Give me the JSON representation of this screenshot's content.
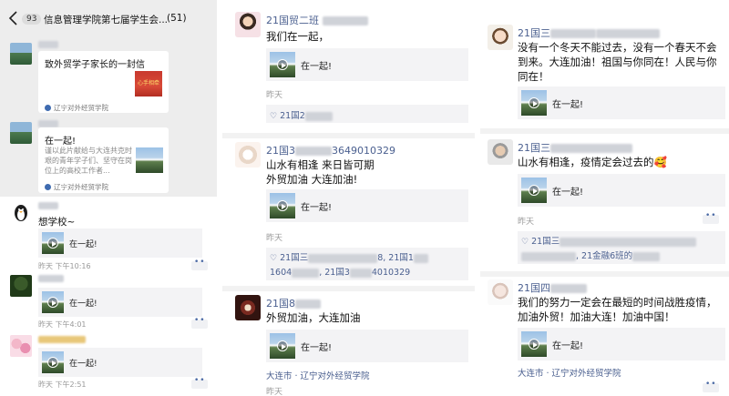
{
  "group_chat": {
    "header": {
      "badge": "93",
      "title": "信息管理学院第七届学生会...",
      "count": "(51)"
    },
    "card1": {
      "title": "致外贸学子家长的一封信",
      "source": "辽宁对外经贸学院"
    },
    "card2": {
      "title": "在一起!",
      "desc": "谨以此片献给与大连共克时艰的青年学子们、坚守在岗位上的高校工作者...",
      "source": "辽宁对外经贸学院"
    },
    "moments": [
      {
        "text": "想学校~",
        "share": "在一起!",
        "time": "昨天 下午10:16"
      },
      {
        "text": "",
        "share": "在一起!",
        "time": "昨天 下午4:01"
      },
      {
        "text": "",
        "share": "在一起!",
        "time": "昨天 下午2:51"
      }
    ]
  },
  "feed_middle": [
    {
      "name": "21国贸二班",
      "text": "我们在一起，",
      "share": "在一起!",
      "time": "昨天",
      "likes": "21国2"
    },
    {
      "name": "21国3",
      "name_suffix": "3649010329",
      "text": "山水有相逢 来日皆可期\n外贸加油 大连加油!",
      "share": "在一起!",
      "time": "昨天",
      "likes_line1": "21国三",
      "likes_line1b": "8, 21国1",
      "likes_line2": "1604",
      "likes_line2b": "21国3",
      "likes_line2c": "4010329"
    },
    {
      "name": "21国8",
      "text": "外贸加油，大连加油",
      "share": "在一起!",
      "location": "大连市 · 辽宁对外经贸学院",
      "time": "昨天"
    }
  ],
  "feed_right": [
    {
      "name": "21国三",
      "text": "没有一个冬天不能过去，没有一个春天不会到来。大连加油！祖国与你同在！人民与你同在！",
      "share": "在一起!"
    },
    {
      "name": "21国三",
      "text": "山水有相逢，疫情定会过去的",
      "emoji": "🥰",
      "share": "在一起!",
      "time": "昨天",
      "likes_line1": "21国三",
      "likes_line2": "21金融6班的"
    },
    {
      "name": "21国四",
      "text": "我们的努力一定会在最短的时间战胜疫情，  加油外贸！加油大连！加油中国！",
      "share": "在一起!",
      "location": "大连市 · 辽宁对外经贸学院"
    }
  ]
}
